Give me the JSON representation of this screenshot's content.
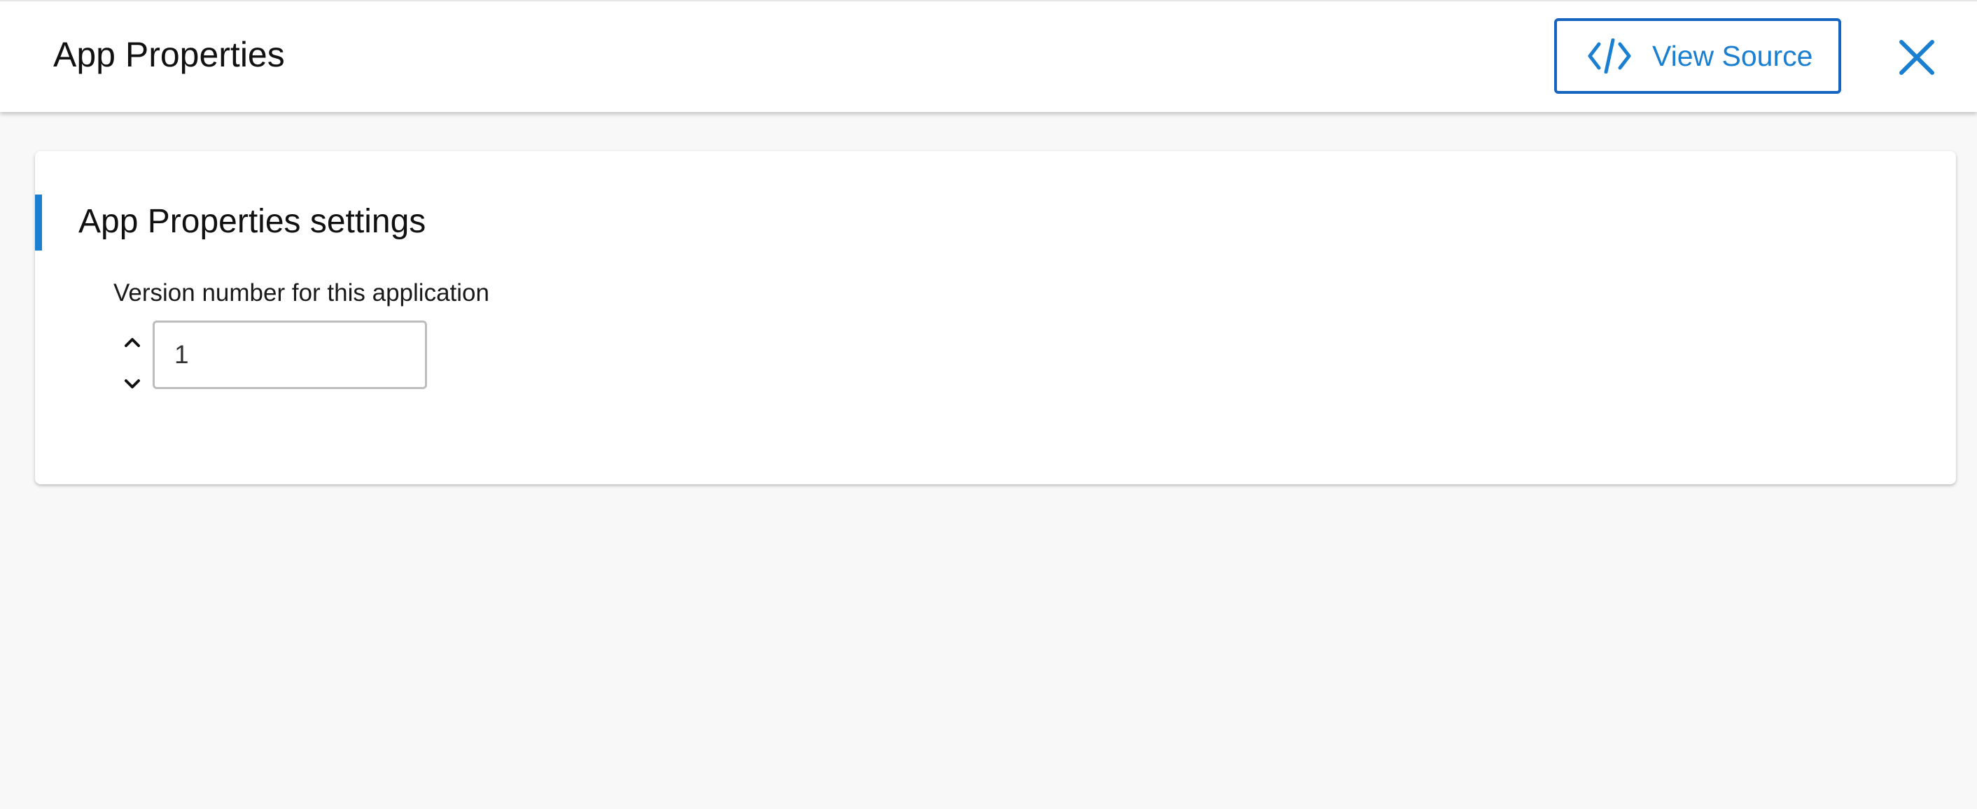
{
  "header": {
    "title": "App Properties",
    "view_source_label": "View Source",
    "view_source_icon": "code-icon",
    "close_icon": "close-icon"
  },
  "settings_card": {
    "title": "App Properties settings",
    "fields": [
      {
        "label": "Version number for this application",
        "value": "1",
        "type": "number",
        "stepper_icons": [
          "chevron-up-icon",
          "chevron-down-icon"
        ]
      }
    ]
  },
  "colors": {
    "accent": "#1b7fd1",
    "accent_border": "#1565c0",
    "background": "#f8f8f8",
    "card": "#ffffff",
    "text": "#1a1a1a"
  }
}
